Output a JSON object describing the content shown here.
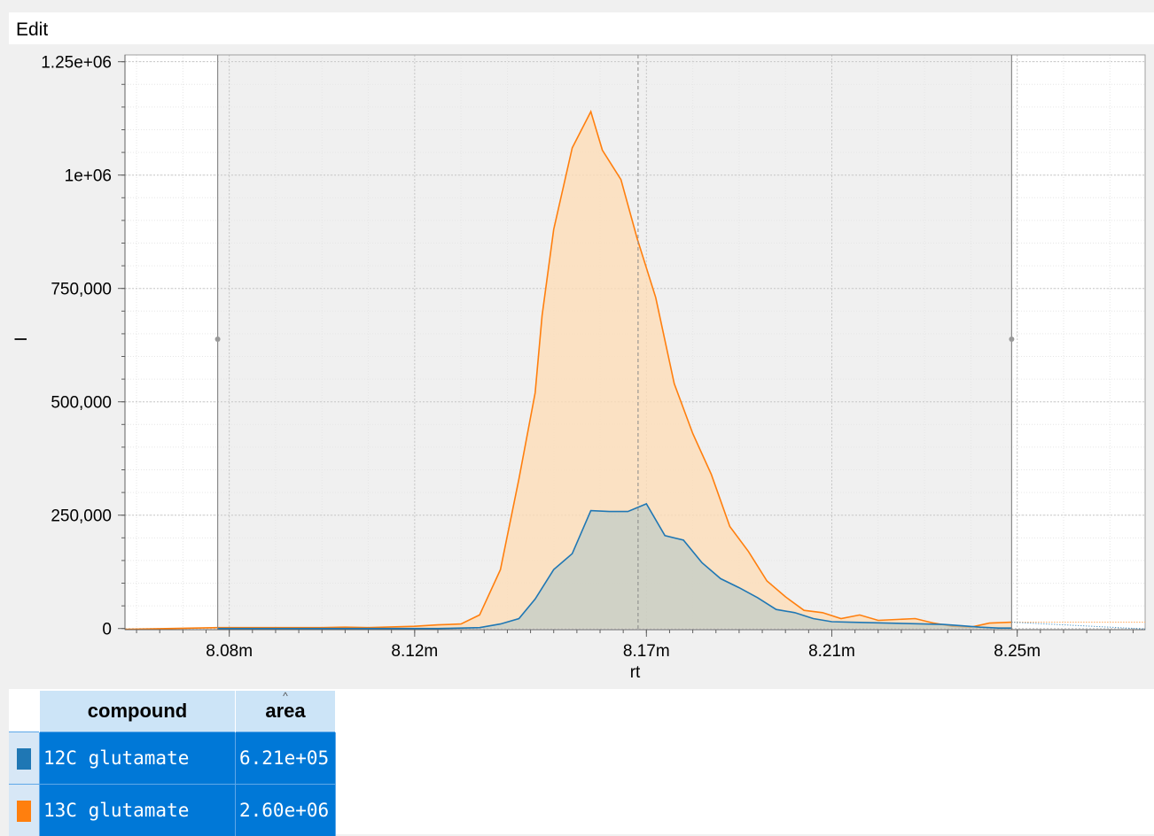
{
  "menu": {
    "edit_label": "Edit"
  },
  "chart_data": {
    "type": "area",
    "xlabel": "rt",
    "ylabel": "I",
    "x_ticks": [
      8.08,
      8.12,
      8.17,
      8.21,
      8.25
    ],
    "x_tick_labels": [
      "8.08m",
      "8.12m",
      "8.17m",
      "8.21m",
      "8.25m"
    ],
    "y_ticks": [
      0,
      250000,
      500000,
      750000,
      1000000,
      1250000
    ],
    "y_tick_labels": [
      "0",
      "250,000",
      "500,000",
      "750,000",
      "1e+06",
      "1.25e+06"
    ],
    "xlim": [
      8.0575,
      8.2776
    ],
    "ylim": [
      -2500,
      1265000
    ],
    "integration_window": [
      8.0775,
      8.2488
    ],
    "apex_rt": 8.1682,
    "grid": true,
    "series": [
      {
        "name": "12C glutamate",
        "color": "#1f77b4",
        "x": [
          8.0775,
          8.08,
          8.09,
          8.1,
          8.11,
          8.12,
          8.125,
          8.13,
          8.134,
          8.1385,
          8.1425,
          8.146,
          8.15,
          8.154,
          8.158,
          8.162,
          8.166,
          8.17,
          8.174,
          8.178,
          8.182,
          8.186,
          8.19,
          8.194,
          8.198,
          8.202,
          8.206,
          8.21,
          8.214,
          8.218,
          8.222,
          8.226,
          8.23,
          8.234,
          8.238,
          8.242,
          8.246,
          8.2488
        ],
        "y": [
          0,
          0,
          0,
          0,
          0,
          0,
          0,
          1000,
          2000,
          10000,
          22000,
          65000,
          130000,
          165000,
          260000,
          258000,
          258000,
          275000,
          205000,
          195000,
          145000,
          110000,
          90000,
          68000,
          42000,
          35000,
          22000,
          15000,
          14000,
          13000,
          12000,
          11000,
          10000,
          9000,
          6000,
          3000,
          1000,
          1000
        ]
      },
      {
        "name": "13C glutamate",
        "color": "#ff7f0e",
        "x": [
          8.0575,
          8.0775,
          8.09,
          8.1,
          8.105,
          8.11,
          8.12,
          8.125,
          8.13,
          8.134,
          8.1385,
          8.1425,
          8.146,
          8.1475,
          8.15,
          8.154,
          8.158,
          8.1605,
          8.1645,
          8.168,
          8.172,
          8.176,
          8.18,
          8.184,
          8.188,
          8.192,
          8.196,
          8.2,
          8.204,
          8.208,
          8.212,
          8.216,
          8.22,
          8.224,
          8.228,
          8.232,
          8.236,
          8.24,
          8.244,
          8.2488
        ],
        "y": [
          -2000,
          2000,
          2000,
          2000,
          3000,
          2000,
          5000,
          8000,
          10000,
          30000,
          130000,
          330000,
          520000,
          690000,
          880000,
          1060000,
          1140000,
          1055000,
          990000,
          860000,
          730000,
          540000,
          430000,
          340000,
          225000,
          170000,
          105000,
          70000,
          40000,
          35000,
          22000,
          30000,
          18000,
          20000,
          22000,
          12000,
          5000,
          3000,
          12000,
          14000
        ]
      }
    ]
  },
  "table": {
    "headers": {
      "compound": "compound",
      "area": "area"
    },
    "rows": [
      {
        "swatch_color": "#1f77b4",
        "compound": "12C glutamate",
        "area": "6.21e+05"
      },
      {
        "swatch_color": "#ff7f0e",
        "compound": "13C glutamate",
        "area": "2.60e+06"
      }
    ]
  }
}
